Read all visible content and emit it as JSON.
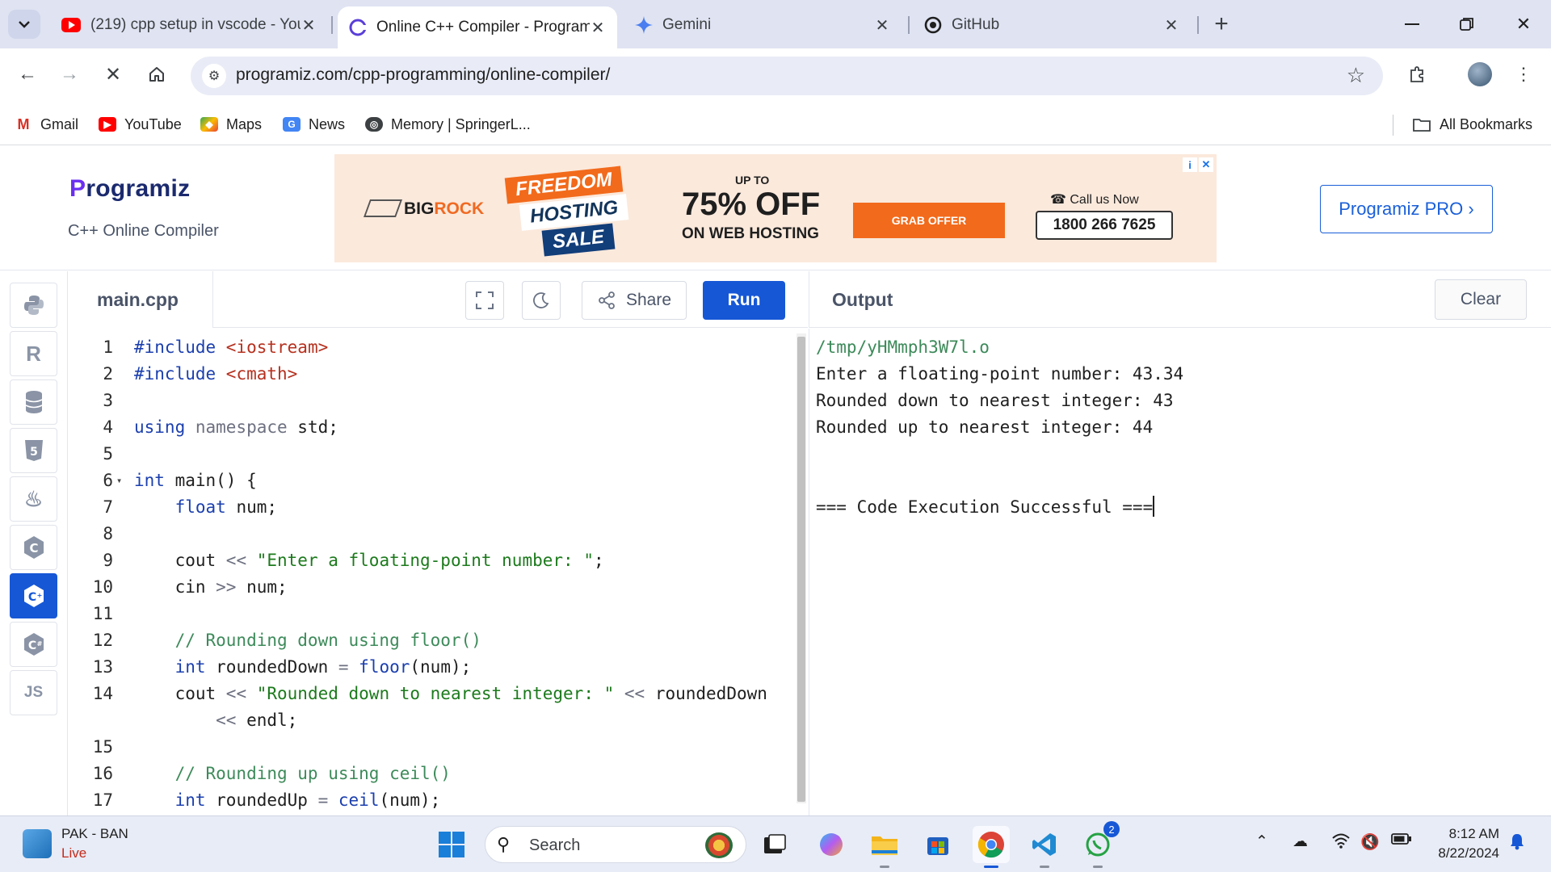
{
  "browser": {
    "tabs": [
      {
        "title": "(219) cpp setup in vscode - You",
        "favicon": "youtube-icon"
      },
      {
        "title": "Online C++ Compiler - Program",
        "favicon": "programiz-icon"
      },
      {
        "title": "Gemini",
        "favicon": "gemini-icon"
      },
      {
        "title": "GitHub",
        "favicon": "github-icon"
      }
    ],
    "url": "programiz.com/cpp-programming/online-compiler/",
    "bookmarks": [
      {
        "label": "Gmail",
        "icon": "gmail-icon"
      },
      {
        "label": "YouTube",
        "icon": "youtube-icon"
      },
      {
        "label": "Maps",
        "icon": "maps-icon"
      },
      {
        "label": "News",
        "icon": "news-icon"
      },
      {
        "label": "Memory | SpringerL...",
        "icon": "globe-icon"
      }
    ],
    "all_bookmarks": "All Bookmarks"
  },
  "header": {
    "logo": "rogramiz",
    "logo_p": "P",
    "subtitle": "C++ Online Compiler",
    "pro_button": "Programiz PRO ›"
  },
  "ad": {
    "brand_big": "BIG",
    "brand_rock": "ROCK",
    "freedom": "FREEDOM",
    "hosting": "HOSTING",
    "sale": "SALE",
    "upto": "UP TO",
    "offer": "75% OFF",
    "on_web": "ON WEB HOSTING",
    "grab": "GRAB OFFER",
    "call": "Call us Now",
    "phone": "1800 266 7625"
  },
  "sidebar": {
    "languages": [
      {
        "name": "python",
        "glyph": "🐍"
      },
      {
        "name": "r",
        "glyph": "R"
      },
      {
        "name": "sql",
        "glyph": "≋"
      },
      {
        "name": "html",
        "glyph": "5"
      },
      {
        "name": "java",
        "glyph": "♨"
      },
      {
        "name": "c",
        "glyph": "C"
      },
      {
        "name": "cpp",
        "glyph": "C+"
      },
      {
        "name": "csharp",
        "glyph": "C#"
      },
      {
        "name": "js",
        "glyph": "JS"
      }
    ],
    "active": "cpp"
  },
  "editor": {
    "filename": "main.cpp",
    "share": "Share",
    "run": "Run",
    "lines": [
      {
        "n": "1",
        "parts": [
          [
            "inc",
            "#include "
          ],
          [
            "hdr",
            "<iostream>"
          ]
        ]
      },
      {
        "n": "2",
        "parts": [
          [
            "inc",
            "#include "
          ],
          [
            "hdr",
            "<cmath>"
          ]
        ]
      },
      {
        "n": "3",
        "parts": []
      },
      {
        "n": "4",
        "parts": [
          [
            "kw",
            "using "
          ],
          [
            "ns",
            "namespace "
          ],
          [
            "",
            "std;"
          ]
        ]
      },
      {
        "n": "5",
        "parts": []
      },
      {
        "n": "6",
        "fold": true,
        "parts": [
          [
            "kw",
            "int "
          ],
          [
            "",
            "main() {"
          ]
        ]
      },
      {
        "n": "7",
        "parts": [
          [
            "",
            "    "
          ],
          [
            "kw",
            "float "
          ],
          [
            "",
            "num;"
          ]
        ]
      },
      {
        "n": "8",
        "parts": []
      },
      {
        "n": "9",
        "parts": [
          [
            "",
            "    cout "
          ],
          [
            "op",
            "<< "
          ],
          [
            "str",
            "\"Enter a floating-point number: \""
          ],
          [
            "",
            ";"
          ]
        ]
      },
      {
        "n": "10",
        "parts": [
          [
            "",
            "    cin "
          ],
          [
            "op",
            ">> "
          ],
          [
            "",
            "num;"
          ]
        ]
      },
      {
        "n": "11",
        "parts": []
      },
      {
        "n": "12",
        "parts": [
          [
            "cmt",
            "    // Rounding down using floor()"
          ]
        ]
      },
      {
        "n": "13",
        "parts": [
          [
            "",
            "    "
          ],
          [
            "kw",
            "int "
          ],
          [
            "",
            "roundedDown "
          ],
          [
            "op",
            "= "
          ],
          [
            "fn",
            "floor"
          ],
          [
            "",
            "(num);"
          ]
        ]
      },
      {
        "n": "14",
        "parts": [
          [
            "",
            "    cout "
          ],
          [
            "op",
            "<< "
          ],
          [
            "str",
            "\"Rounded down to nearest integer: \""
          ],
          [
            "op",
            " << "
          ],
          [
            "",
            "roundedDown"
          ]
        ]
      },
      {
        "n": "",
        "parts": [
          [
            "",
            "        "
          ],
          [
            "op",
            "<< "
          ],
          [
            "",
            "endl;"
          ]
        ]
      },
      {
        "n": "15",
        "parts": []
      },
      {
        "n": "16",
        "parts": [
          [
            "cmt",
            "    // Rounding up using ceil()"
          ]
        ]
      },
      {
        "n": "17",
        "parts": [
          [
            "",
            "    "
          ],
          [
            "kw",
            "int "
          ],
          [
            "",
            "roundedUp "
          ],
          [
            "op",
            "= "
          ],
          [
            "fn",
            "ceil"
          ],
          [
            "",
            "(num);"
          ]
        ]
      }
    ]
  },
  "output": {
    "title": "Output",
    "clear": "Clear",
    "lines": [
      {
        "text": "/tmp/yHMmph3W7l.o",
        "kind": "path"
      },
      {
        "text": "Enter a floating-point number: 43.34",
        "kind": "normal"
      },
      {
        "text": "Rounded down to nearest integer: 43",
        "kind": "normal"
      },
      {
        "text": "Rounded up to nearest integer: 44",
        "kind": "normal"
      },
      {
        "text": "",
        "kind": "normal"
      },
      {
        "text": "",
        "kind": "normal"
      },
      {
        "text": "=== Code Execution Successful ===",
        "kind": "final"
      }
    ]
  },
  "taskbar": {
    "weather_title": "PAK - BAN",
    "weather_sub": "Live",
    "search": "Search",
    "time": "8:12 AM",
    "date": "8/22/2024",
    "whatsapp_badge": "2"
  }
}
